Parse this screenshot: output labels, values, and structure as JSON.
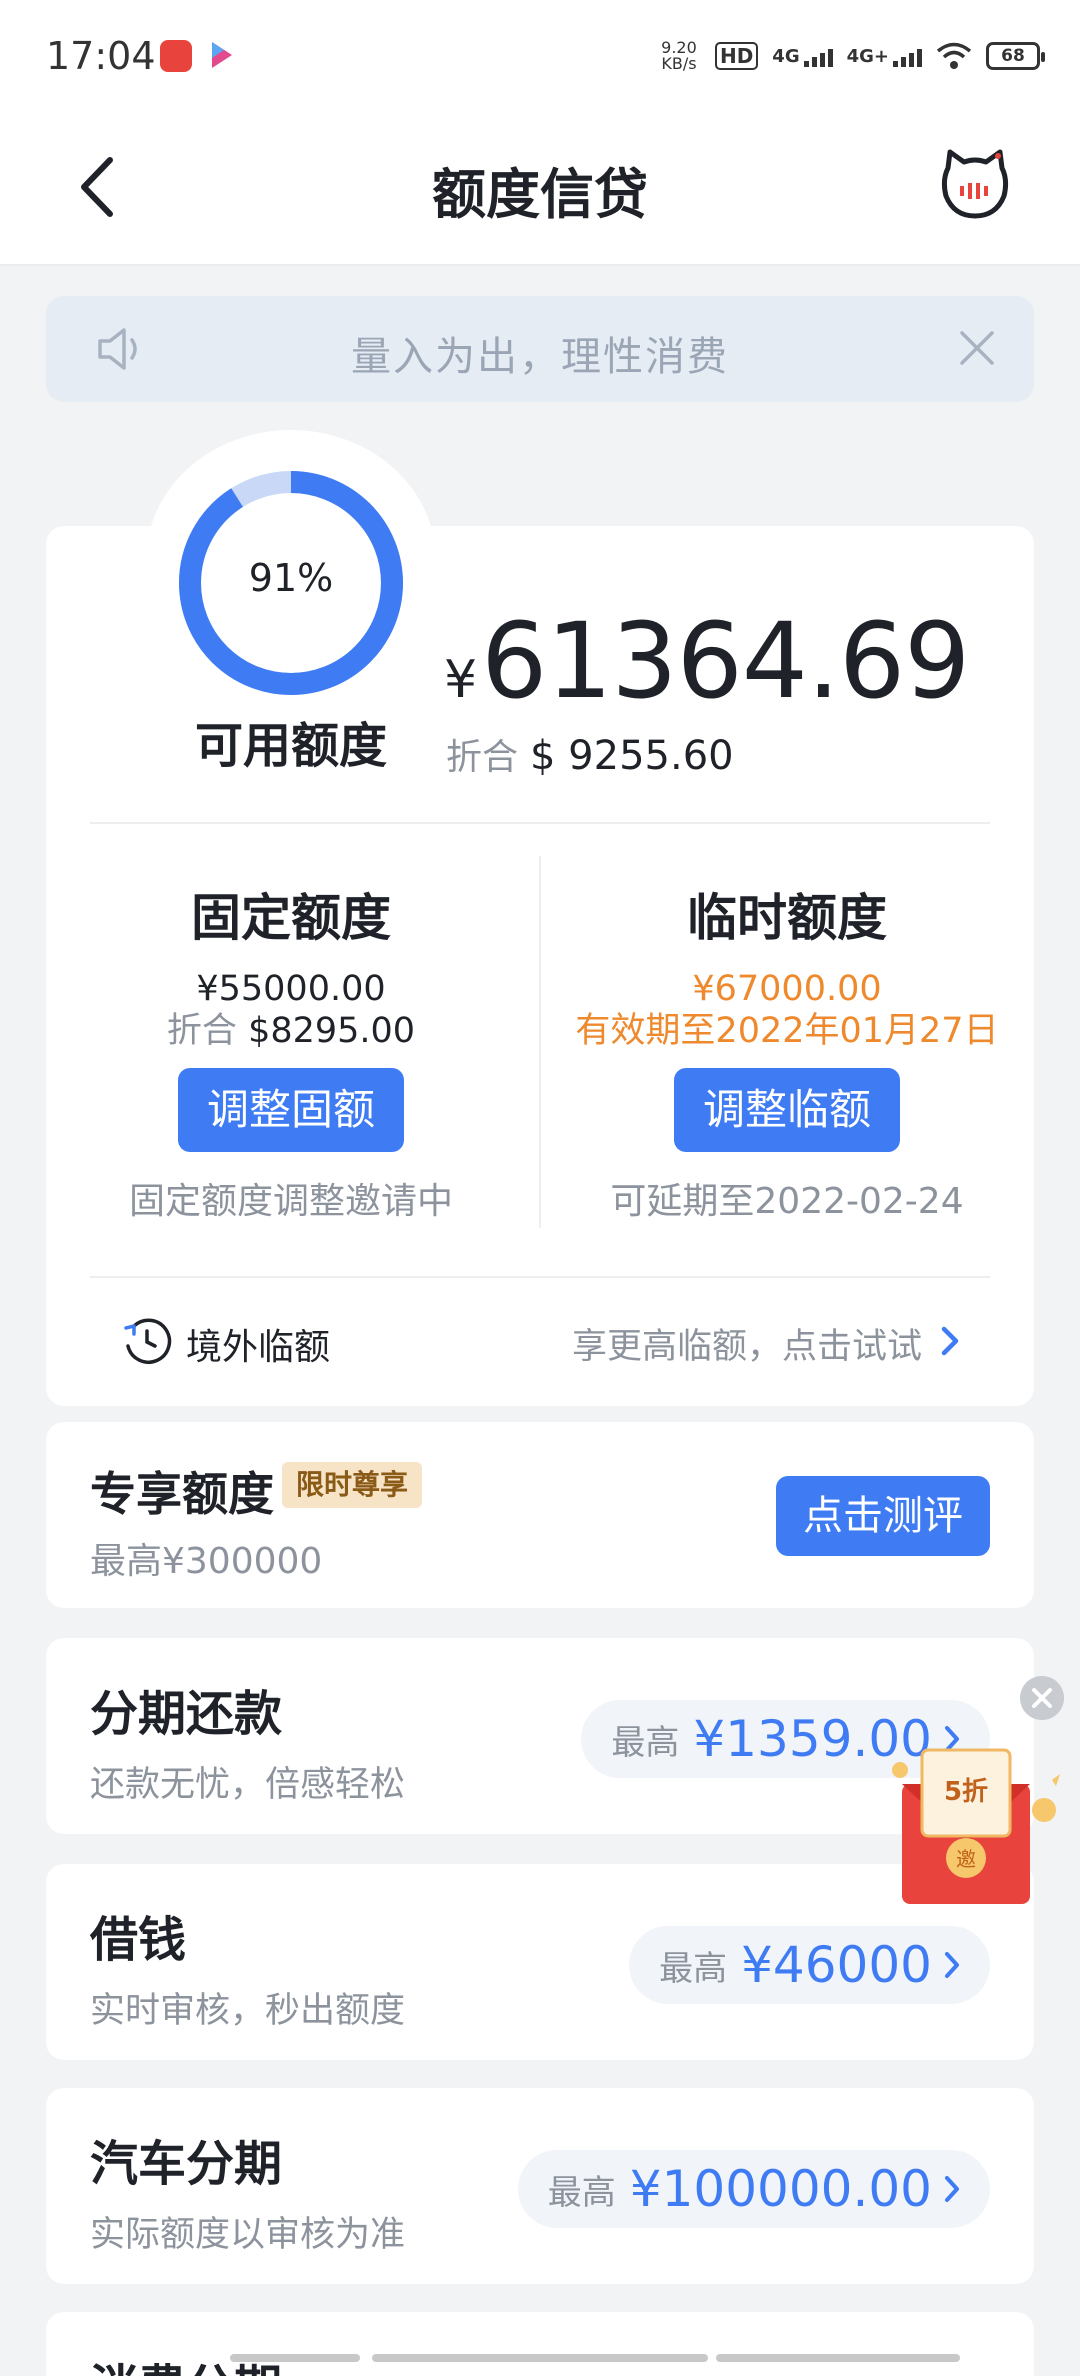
{
  "status_bar": {
    "time": "17:04",
    "net_speed": "9.20 KB/s",
    "hd_label": "HD",
    "network_1": "4G",
    "network_2": "4G+",
    "battery": "68"
  },
  "nav": {
    "title": "额度信贷"
  },
  "notice": {
    "text": "量入为出，理性消费"
  },
  "credit": {
    "available_percent": 91,
    "percent_text": "91%",
    "available_label": "可用额度",
    "currency_symbol": "¥",
    "available_amount": "61364.69",
    "usd_label": "折合",
    "usd_amount": "$ 9255.60"
  },
  "fixed": {
    "title": "固定额度",
    "amount": "¥55000.00",
    "usd_label": "折合",
    "usd_amount": "$8295.00",
    "button": "调整固额",
    "note": "固定额度调整邀请中"
  },
  "temporary": {
    "title": "临时额度",
    "amount": "¥67000.00",
    "validity": "有效期至2022年01月27日",
    "button": "调整临额",
    "note": "可延期至2022-02-24"
  },
  "overseas": {
    "label": "境外临额",
    "hint": "享更高临额，点击试试"
  },
  "exclusive": {
    "title": "专享额度",
    "tag": "限时尊享",
    "subtitle": "最高¥300000",
    "button": "点击测评"
  },
  "products": [
    {
      "title": "分期还款",
      "subtitle": "还款无忧，倍感轻松",
      "max_label": "最高",
      "max_value": "¥1359.00"
    },
    {
      "title": "借钱",
      "subtitle": "实时审核，秒出额度",
      "max_label": "最高",
      "max_value": "¥46000"
    },
    {
      "title": "汽车分期",
      "subtitle": "实际额度以审核为准",
      "max_label": "最高",
      "max_value": "¥100000.00"
    }
  ],
  "bottom": {
    "title": "消费分期"
  },
  "floating_promo": {
    "discount": "5折",
    "seal": "邀"
  },
  "colors": {
    "accent": "#3f7cf4",
    "ring_track": "#c9d8f6",
    "orange": "#ee8a2d",
    "tag_bg": "#f7e3c6",
    "red_packet": "#e8433c"
  }
}
